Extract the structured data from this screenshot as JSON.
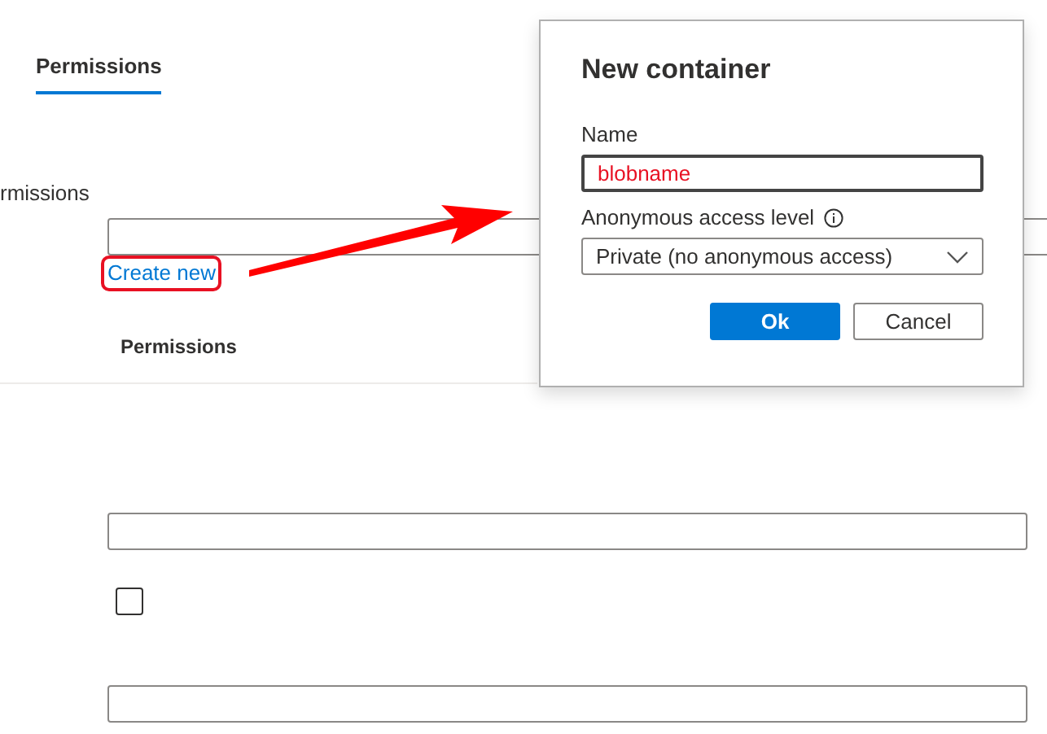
{
  "tabs": [
    {
      "label": "Permissions",
      "selected": true
    }
  ],
  "form": {
    "field_label": "rmissions",
    "create_link": "Create new",
    "section_header": "Permissions",
    "checkbox": {
      "checked": false
    }
  },
  "dialog": {
    "title": "New container",
    "name_label": "Name",
    "name_value": "blobname",
    "access_label": "Anonymous access level",
    "access_value": "Private (no anonymous access)",
    "buttons": [
      {
        "label": "Ok",
        "kind": "primary"
      },
      {
        "label": "Cancel",
        "kind": "secondary"
      }
    ]
  }
}
